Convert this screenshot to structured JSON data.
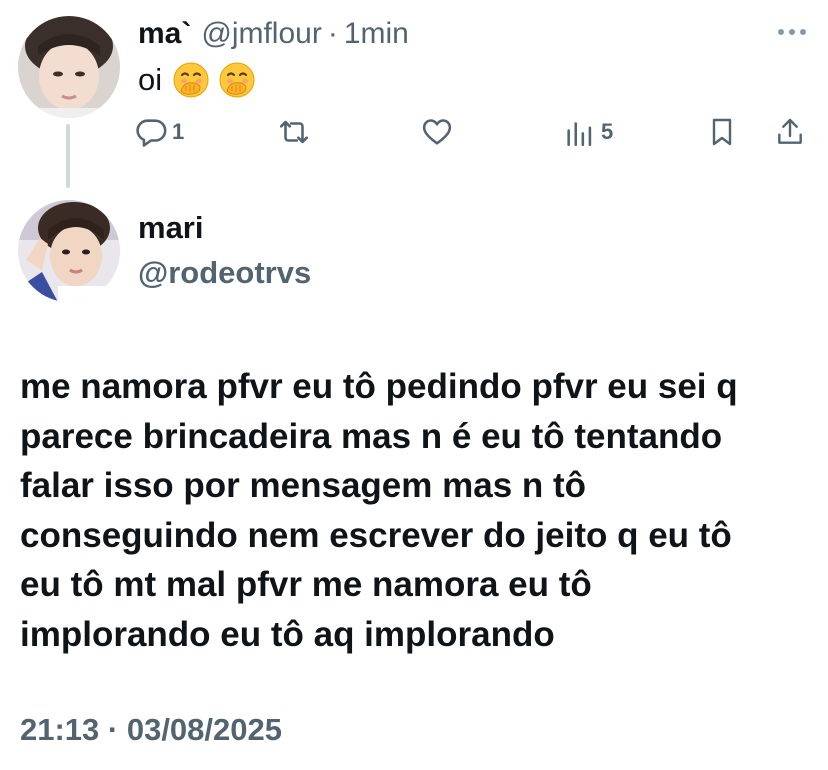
{
  "reply": {
    "name": "ma",
    "name_mark": "`",
    "handle": "@jmflour",
    "separator": "·",
    "time": "1min",
    "text": "oi",
    "emojis": [
      "hand-over-mouth-emoji",
      "hand-over-mouth-emoji"
    ],
    "actions": {
      "reply_count": "1",
      "views_count": "5"
    }
  },
  "tweet": {
    "name": "mari",
    "handle": "@rodeotrvs",
    "text_lines": [
      "me namora pfvr eu tô pedindo pfvr eu sei q",
      "parece brincadeira mas n é eu tô tentando",
      "falar isso por mensagem mas n tô",
      "conseguindo nem escrever do jeito q eu tô",
      "eu tô mt mal pfvr me namora eu tô",
      "implorando eu tô aq implorando"
    ],
    "timestamp": "21:13 · 03/08/2025"
  },
  "colors": {
    "text": "#0f1419",
    "secondary": "#536471",
    "thread_line": "#cfd9de",
    "emoji": "#ffc83d"
  }
}
